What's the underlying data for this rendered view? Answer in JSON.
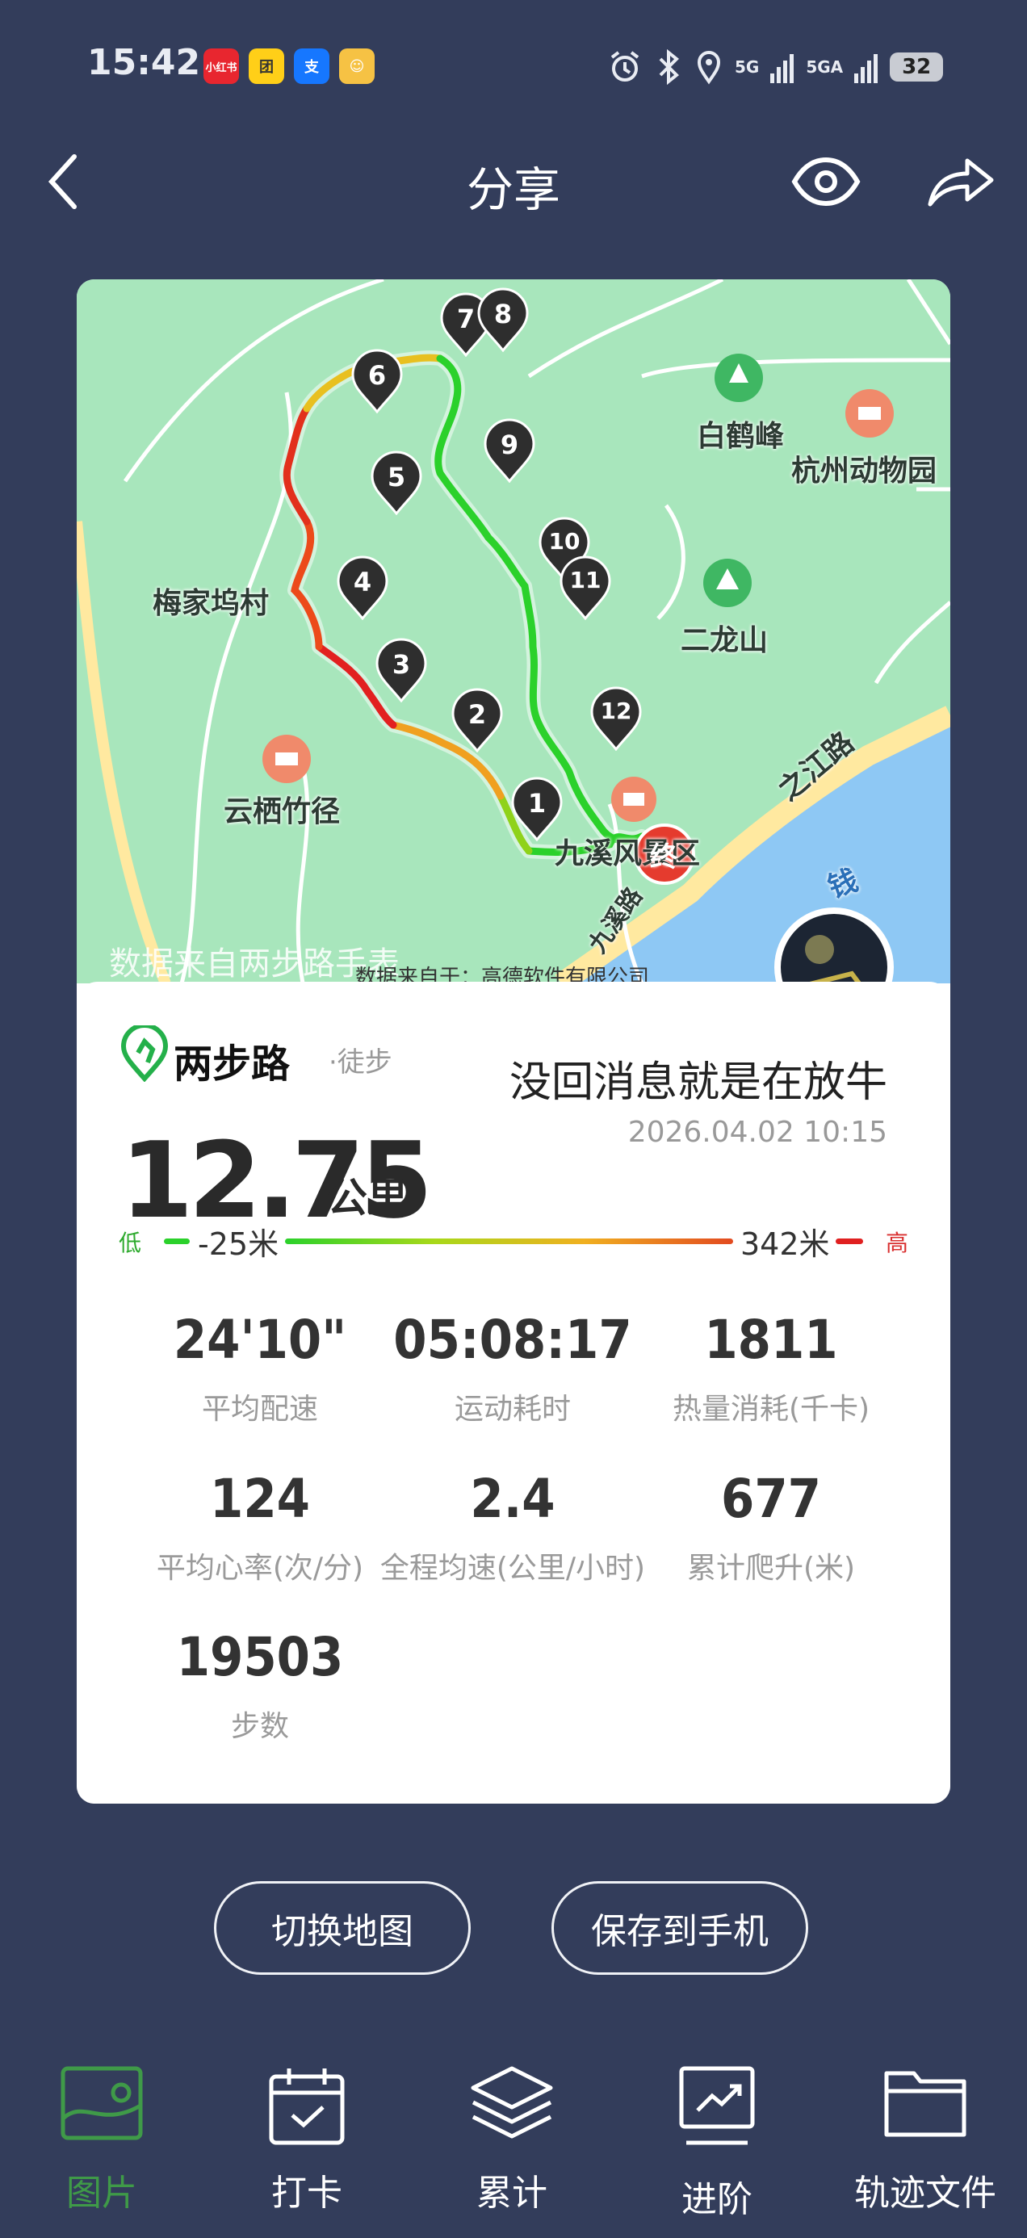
{
  "status_bar": {
    "time": "15:42",
    "apps": [
      "小红书",
      "团",
      "支",
      "☺"
    ],
    "network": [
      "5G",
      "5GA"
    ],
    "battery": "32"
  },
  "header": {
    "title": "分享"
  },
  "map": {
    "labels": {
      "meijiawu": "梅家坞村",
      "baihefeng": "白鹤峰",
      "zoo": "杭州动物园",
      "erlongshan": "二龙山",
      "yunqi": "云栖竹径",
      "jiuxi": "九溪风景区",
      "zhijiang": "之江路",
      "qian": "钱",
      "jiuxi_road": "九溪路",
      "end": "终"
    },
    "waypoints": [
      "1",
      "2",
      "3",
      "4",
      "5",
      "6",
      "7",
      "8",
      "9",
      "10",
      "11",
      "12"
    ],
    "watermark": "数据来自两步路手表",
    "copyright": "数据来自于：高德软件有限公司"
  },
  "card": {
    "brand_name": "两步路",
    "activity_type": "·徒步",
    "username": "没回消息就是在放牛",
    "datetime": "2026.04.02 10:15",
    "distance": "12.75",
    "distance_unit": "公里",
    "elevation": {
      "low_label": "低",
      "high_label": "高",
      "min": "-25米",
      "max": "342米"
    },
    "stats": [
      {
        "value": "24'10\"",
        "label": "平均配速"
      },
      {
        "value": "05:08:17",
        "label": "运动耗时"
      },
      {
        "value": "1811",
        "label": "热量消耗(千卡)"
      },
      {
        "value": "124",
        "label": "平均心率(次/分)"
      },
      {
        "value": "2.4",
        "label": "全程均速(公里/小时)"
      },
      {
        "value": "677",
        "label": "累计爬升(米)"
      },
      {
        "value": "19503",
        "label": "步数"
      }
    ]
  },
  "buttons": {
    "switch_map": "切换地图",
    "save_to_phone": "保存到手机"
  },
  "nav": {
    "items": [
      {
        "label": "图片",
        "active": true
      },
      {
        "label": "打卡"
      },
      {
        "label": "累计"
      },
      {
        "label": "进阶"
      },
      {
        "label": "轨迹文件"
      }
    ]
  },
  "colors": {
    "background": "#333d5b",
    "active_nav": "#3f9a48",
    "track_low": "#2bd12b",
    "track_high": "#e02020"
  }
}
